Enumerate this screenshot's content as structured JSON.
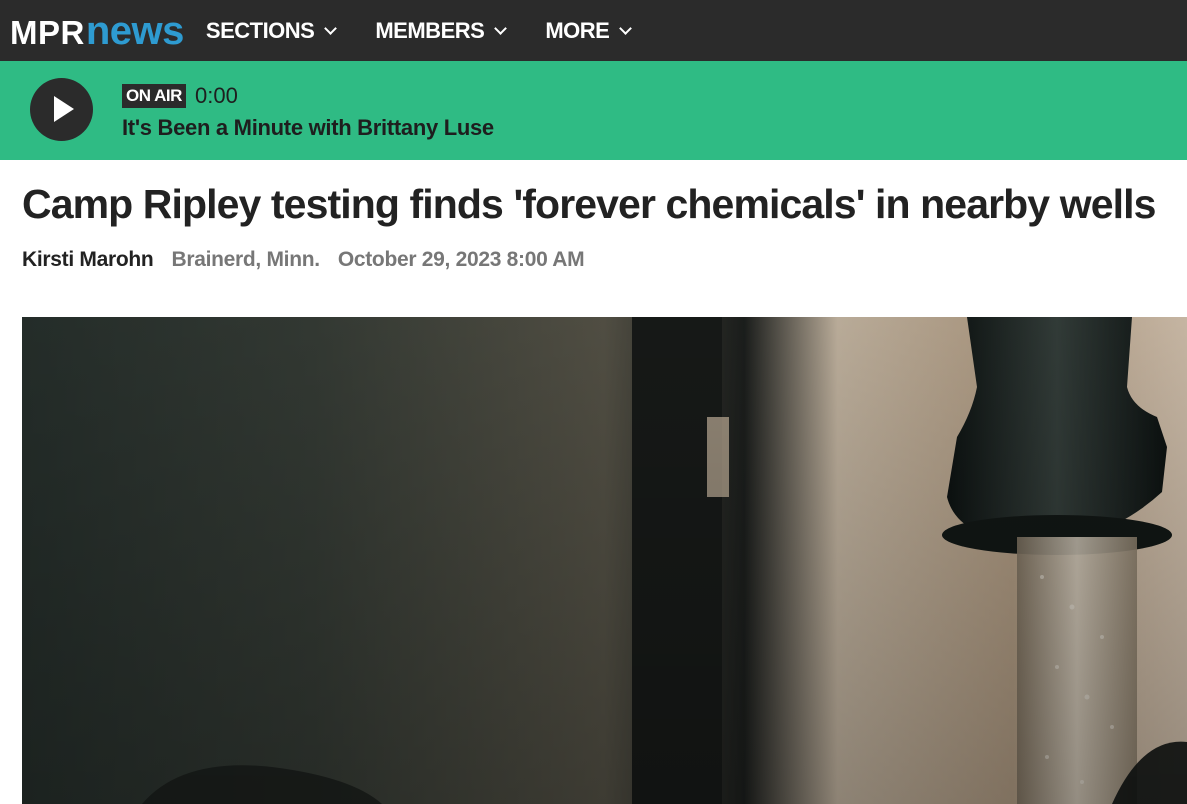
{
  "header": {
    "logo_mpr": "MPR",
    "logo_news": "news",
    "nav": [
      {
        "label": "SECTIONS"
      },
      {
        "label": "MEMBERS"
      },
      {
        "label": "MORE"
      }
    ]
  },
  "player": {
    "badge": "ON AIR",
    "time": "0:00",
    "show_title": "It's Been a Minute with Brittany Luse",
    "play_icon": "play-icon"
  },
  "article": {
    "headline": "Camp Ripley testing finds 'forever chemicals' in nearby wells",
    "author": "Kirsti Marohn",
    "location": "Brainerd, Minn.",
    "date": "October 29, 2023 8:00 AM",
    "photo_subject": "water-faucet-photo"
  },
  "colors": {
    "topbar": "#2b2b2b",
    "player_bg": "#2fbb84",
    "logo_news": "#2e9bd1"
  }
}
